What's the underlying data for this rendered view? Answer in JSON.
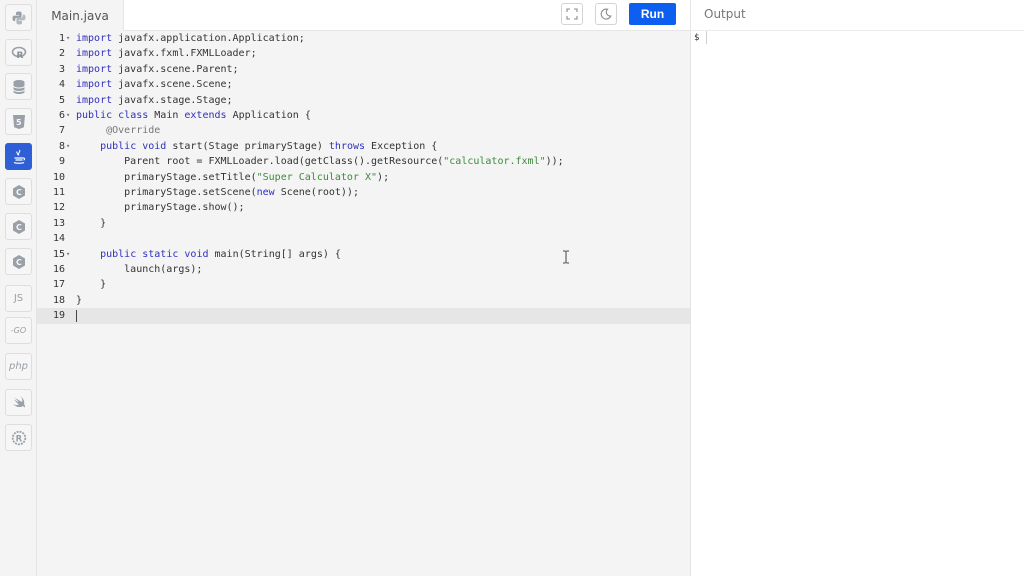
{
  "sidebar": {
    "items": [
      {
        "icon": "python-icon",
        "label": ""
      },
      {
        "icon": "r-icon",
        "label": ""
      },
      {
        "icon": "database-icon",
        "label": ""
      },
      {
        "icon": "html5-icon",
        "label": ""
      },
      {
        "icon": "java-icon",
        "label": "",
        "active": true
      },
      {
        "icon": "c-icon",
        "label": ""
      },
      {
        "icon": "cpp-icon",
        "label": ""
      },
      {
        "icon": "csharp-icon",
        "label": ""
      },
      {
        "icon": "javascript-icon",
        "label": "JS"
      },
      {
        "icon": "go-icon",
        "label": "-GO"
      },
      {
        "icon": "php-icon",
        "label": "php"
      },
      {
        "icon": "swift-icon",
        "label": ""
      },
      {
        "icon": "rust-icon",
        "label": ""
      }
    ]
  },
  "toolbar": {
    "file_tab": "Main.java",
    "run_label": "Run"
  },
  "editor": {
    "current_line": 19,
    "lines": [
      {
        "n": "1",
        "fold": true,
        "html": "<span class=\"kw\">import</span> javafx.application.Application;"
      },
      {
        "n": "2",
        "fold": false,
        "html": "<span class=\"kw\">import</span> javafx.fxml.FXMLLoader;"
      },
      {
        "n": "3",
        "fold": false,
        "html": "<span class=\"kw\">import</span> javafx.scene.Parent;"
      },
      {
        "n": "4",
        "fold": false,
        "html": "<span class=\"kw\">import</span> javafx.scene.Scene;"
      },
      {
        "n": "5",
        "fold": false,
        "html": "<span class=\"kw\">import</span> javafx.stage.Stage;"
      },
      {
        "n": "6",
        "fold": true,
        "html": "<span class=\"kw\">public</span> <span class=\"kw\">class</span> Main <span class=\"kw\">extends</span> Application {"
      },
      {
        "n": "7",
        "fold": false,
        "html": "     <span class=\"ann\">@Override</span>"
      },
      {
        "n": "8",
        "fold": true,
        "html": "    <span class=\"kw\">public</span> <span class=\"kw\">void</span> start(Stage primaryStage) <span class=\"kw\">throws</span> Exception {"
      },
      {
        "n": "9",
        "fold": false,
        "html": "        Parent root = FXMLLoader.load(getClass().getResource(<span class=\"str\">\"calculator.fxml\"</span>));"
      },
      {
        "n": "10",
        "fold": false,
        "html": "        primaryStage.setTitle(<span class=\"str\">\"Super Calculator X\"</span>);"
      },
      {
        "n": "11",
        "fold": false,
        "html": "        primaryStage.setScene(<span class=\"kw\">new</span> Scene(root));"
      },
      {
        "n": "12",
        "fold": false,
        "html": "        primaryStage.show();"
      },
      {
        "n": "13",
        "fold": false,
        "html": "    }"
      },
      {
        "n": "14",
        "fold": false,
        "html": ""
      },
      {
        "n": "15",
        "fold": true,
        "html": "    <span class=\"kw\">public</span> <span class=\"kw\">static</span> <span class=\"kw\">void</span> main(String[] args) {"
      },
      {
        "n": "16",
        "fold": false,
        "html": "        launch(args);"
      },
      {
        "n": "17",
        "fold": false,
        "html": "    }"
      },
      {
        "n": "18",
        "fold": false,
        "html": "}"
      },
      {
        "n": "19",
        "fold": false,
        "html": ""
      }
    ]
  },
  "output": {
    "title": "Output",
    "prompt": "$"
  }
}
